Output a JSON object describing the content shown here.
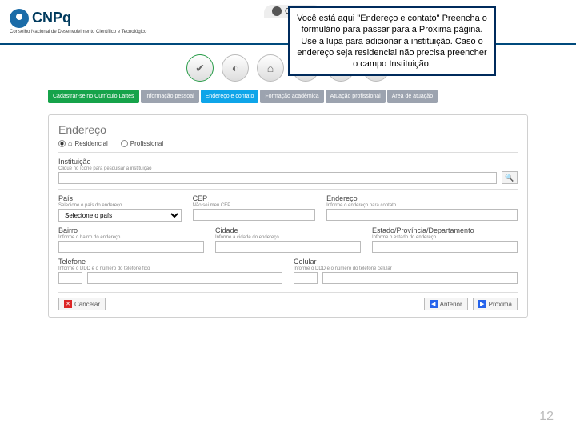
{
  "header": {
    "logo_text": "CNPq",
    "logo_sub": "Conselho Nacional de Desenvolvimento Científico e Tecnológico",
    "curric_label": "Curríc..."
  },
  "callout": "Você está aqui \"Endereço e contato\" Preencha o formulário para passar para a Próxima página. Use a lupa para adicionar a instituição. Caso o endereço seja residencial não precisa preencher o campo Instituição.",
  "tabs": {
    "t1": "Cadastrar-se no Currículo Lattes",
    "t2": "Informação pessoal",
    "t3": "Endereço e contato",
    "t4": "Formação acadêmica",
    "t5": "Atuação profissional",
    "t6": "Área de atuação"
  },
  "form": {
    "section_endereco": "Endereço",
    "radio_residencial": "Residencial",
    "radio_profissional": "Profissional",
    "instituicao_label": "Instituição",
    "instituicao_hint": "Clique no ícone para pesquisar a instituição",
    "pais_label": "País",
    "pais_hint": "Selecione o país do endereço",
    "pais_placeholder": "Selecione o país",
    "cep_label": "CEP",
    "cep_hint": "Não sei meu CEP",
    "endereco_label": "Endereço",
    "endereco_hint": "Informe o endereço para contato",
    "bairro_label": "Bairro",
    "bairro_hint": "Informe o bairro do endereço",
    "cidade_label": "Cidade",
    "cidade_hint": "Informe a cidade do endereço",
    "estado_label": "Estado/Província/Departamento",
    "estado_hint": "Informe o estado do endereço",
    "telefone_label": "Telefone",
    "telefone_hint": "Informe o DDD e o número do telefone fixo",
    "celular_label": "Celular",
    "celular_hint": "Informe o DDD e o número do telefone celular"
  },
  "buttons": {
    "cancelar": "Cancelar",
    "anterior": "Anterior",
    "proxima": "Próxima"
  },
  "page_number": "12"
}
